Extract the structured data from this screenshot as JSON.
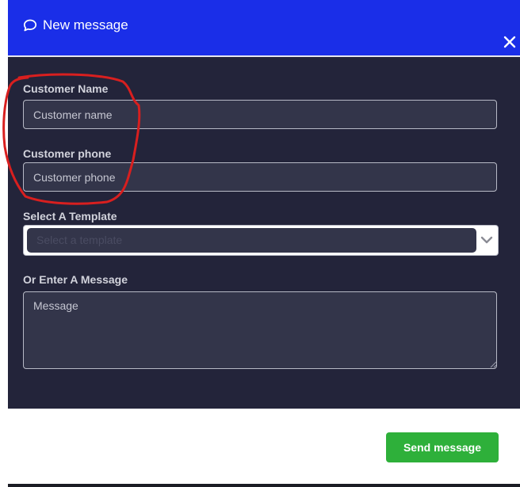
{
  "header": {
    "title": "New message",
    "icon": "chat-bubble-icon",
    "close_icon": "close-icon"
  },
  "form": {
    "customer_name": {
      "label": "Customer Name",
      "placeholder": "Customer name",
      "value": ""
    },
    "customer_phone": {
      "label": "Customer phone",
      "placeholder": "Customer phone",
      "value": ""
    },
    "template": {
      "label": "Select A Template",
      "placeholder": "Select a template"
    },
    "message": {
      "label": "Or Enter A Message",
      "placeholder": "Message",
      "value": ""
    }
  },
  "footer": {
    "send_label": "Send message"
  },
  "colors": {
    "header_bg": "#1a2ee8",
    "panel_bg": "#23243a",
    "field_bg": "#33354a",
    "accent": "#2eb03a",
    "annotation": "#d81f1f"
  }
}
